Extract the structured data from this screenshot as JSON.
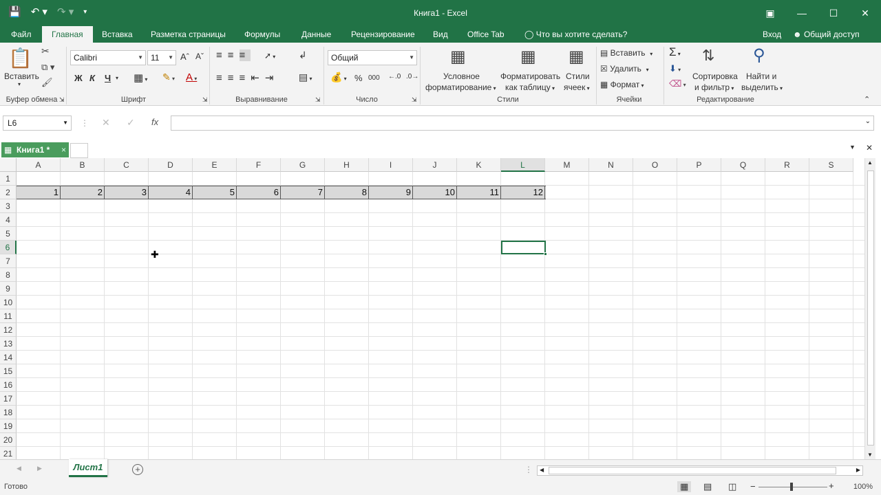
{
  "window": {
    "title": "Книга1 - Excel"
  },
  "qat": {
    "save_icon": "save-icon",
    "undo_icon": "undo-icon",
    "redo_icon": "redo-icon"
  },
  "tabs": {
    "file": "Файл",
    "home": "Главная",
    "insert": "Вставка",
    "page_layout": "Разметка страницы",
    "formulas": "Формулы",
    "data": "Данные",
    "review": "Рецензирование",
    "view": "Вид",
    "office_tab": "Office Tab",
    "tell_me": "Что вы хотите сделать?",
    "sign_in": "Вход",
    "share": "Общий доступ"
  },
  "ribbon": {
    "paste": "Вставить",
    "clipboard": "Буфер обмена",
    "font_name": "Calibri",
    "font_size": "11",
    "bold": "Ж",
    "italic": "К",
    "underline": "Ч",
    "font": "Шрифт",
    "alignment": "Выравнивание",
    "number_format": "Общий",
    "percent": "%",
    "thousands": "000",
    "number": "Число",
    "cond_format_1": "Условное",
    "cond_format_2": "форматирование",
    "format_table_1": "Форматировать",
    "format_table_2": "как таблицу",
    "cell_styles_1": "Стили",
    "cell_styles_2": "ячеек",
    "styles": "Стили",
    "insert_cells": "Вставить",
    "delete_cells": "Удалить",
    "format_cells": "Формат",
    "cells": "Ячейки",
    "sort_1": "Сортировка",
    "sort_2": "и фильтр",
    "find_1": "Найти и",
    "find_2": "выделить",
    "editing": "Редактирование"
  },
  "formula_bar": {
    "name_box": "L6",
    "fx": "fx",
    "value": ""
  },
  "office_tab": {
    "doc_name": "Книга1 *"
  },
  "grid": {
    "columns": [
      "A",
      "B",
      "C",
      "D",
      "E",
      "F",
      "G",
      "H",
      "I",
      "J",
      "K",
      "L",
      "M",
      "N",
      "O",
      "P",
      "Q",
      "R",
      "S"
    ],
    "rows": [
      "1",
      "2",
      "3",
      "4",
      "5",
      "6",
      "7",
      "8",
      "9",
      "10",
      "11",
      "12",
      "13",
      "14",
      "15",
      "16",
      "17",
      "18",
      "19",
      "20",
      "21"
    ],
    "row2_values": [
      "1",
      "2",
      "3",
      "4",
      "5",
      "6",
      "7",
      "8",
      "9",
      "10",
      "11",
      "12"
    ],
    "selected_column": "L",
    "selected_row": "6"
  },
  "sheets": {
    "active": "Лист1",
    "add": "+"
  },
  "status": {
    "ready": "Готово",
    "zoom": "100%"
  }
}
